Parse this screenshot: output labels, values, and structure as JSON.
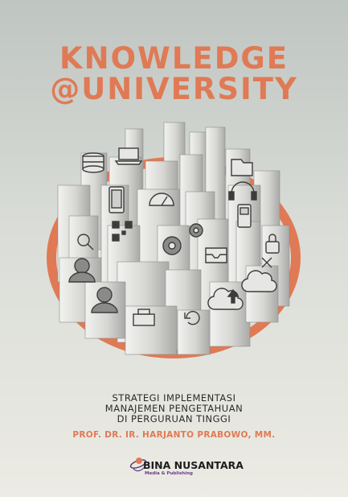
{
  "cover": {
    "title_line1": "KNOWLEDGE",
    "title_line2": "@UNIVERSITY",
    "subtitle_line1": "STRATEGI IMPLEMENTASI",
    "subtitle_line2": "MANAJEMEN PENGETAHUAN",
    "subtitle_line3": "DI PERGURUAN TINGGI",
    "author": "PROF. DR. IR. HARJANTO PRABOWO, MM."
  },
  "publisher": {
    "name": "BINA NUSANTARA",
    "tagline": "Media & Publishing"
  },
  "colors": {
    "accent": "#e07a55",
    "background_top": "#bfc5c1",
    "background_bottom": "#ecebe4",
    "pillar": "#d8d8d6",
    "text": "#2a2a2a"
  },
  "illustration": {
    "icons": [
      "database-icon",
      "laptop-icon",
      "speedometer-icon",
      "folder-icon",
      "headset-icon",
      "smartphone-icon",
      "qr-code-icon",
      "search-icon",
      "gear-icon",
      "inbox-icon",
      "cloud-icon",
      "user-icon",
      "printer-icon",
      "refresh-icon",
      "upload-icon",
      "phone-icon",
      "lock-icon",
      "close-icon"
    ]
  }
}
